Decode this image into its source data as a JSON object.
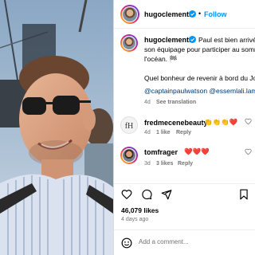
{
  "post": {
    "author": "hugoclementk",
    "follow_label": "Follow",
    "dot": "•"
  },
  "caption": {
    "username": "hugoclementk",
    "lines": [
      "Paul est bien arrivé à",
      "son équipage pour participer au somm",
      "l'océan. 🏁",
      "",
      "Quel bonheur de revenir à bord du Joh"
    ],
    "mentions": "@captainpaulwatson @essemlali.lamya",
    "time": "4d",
    "see_translation": "See translation"
  },
  "comments": [
    {
      "username": "fredmecenebeauty",
      "text": "👏👏👏❤️",
      "hearts": "❤️",
      "time": "4d",
      "likes": "1 like",
      "reply": "Reply"
    },
    {
      "username": "tomfrager",
      "text": "",
      "hearts": "❤️❤️❤️",
      "time": "3d",
      "likes": "3 likes",
      "reply": "Reply"
    }
  ],
  "stats": {
    "likes": "46,079 likes",
    "date": "4 days ago"
  },
  "composer": {
    "placeholder": "Add a comment..."
  },
  "colors": {
    "accent": "#0095f6",
    "mention": "#00376b",
    "heart": "#ed4956"
  }
}
